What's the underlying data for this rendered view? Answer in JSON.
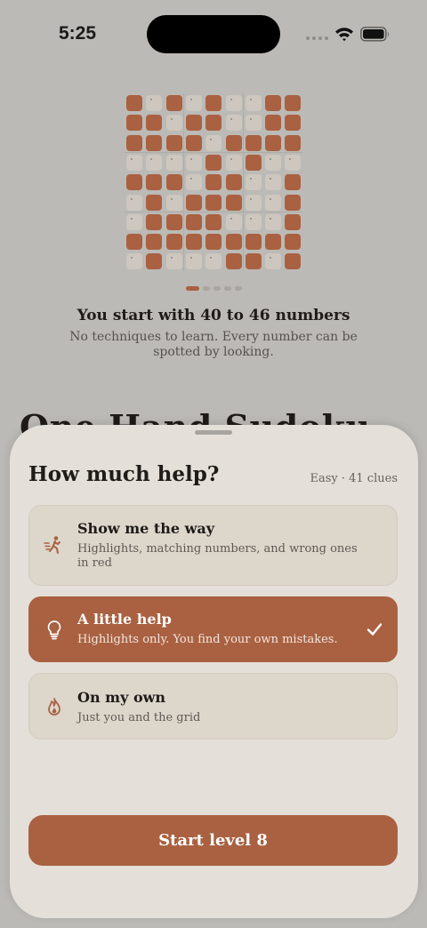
{
  "status_bar": {
    "time": "5:25"
  },
  "onboarding": {
    "grid_rows": [
      "101010011",
      "110110011",
      "111101111",
      "000010100",
      "111011001",
      "010111001",
      "011110001",
      "111111111",
      "010001101"
    ],
    "pager": {
      "count": 5,
      "active_index": 0
    },
    "slide_title": "You start with 40 to 46 numbers",
    "slide_description": "No techniques to learn. Every number can be spotted by looking.",
    "background_title": "One Hand Sudoku"
  },
  "sheet": {
    "title": "How much help?",
    "meta": "Easy · 41 clues",
    "options": [
      {
        "title": "Show me the way",
        "description": "Highlights, matching numbers, and wrong ones in red",
        "icon": "walking-person-icon",
        "selected": false
      },
      {
        "title": "A little help",
        "description": "Highlights only. You find your own mistakes.",
        "icon": "lightbulb-icon",
        "selected": true
      },
      {
        "title": "On my own",
        "description": "Just you and the grid",
        "icon": "flame-icon",
        "selected": false
      }
    ],
    "start_button": "Start level 8"
  },
  "colors": {
    "accent": "#a96141",
    "background": "#bcbab6",
    "sheet": "#e4e0d9",
    "option": "#ddd6cb"
  }
}
